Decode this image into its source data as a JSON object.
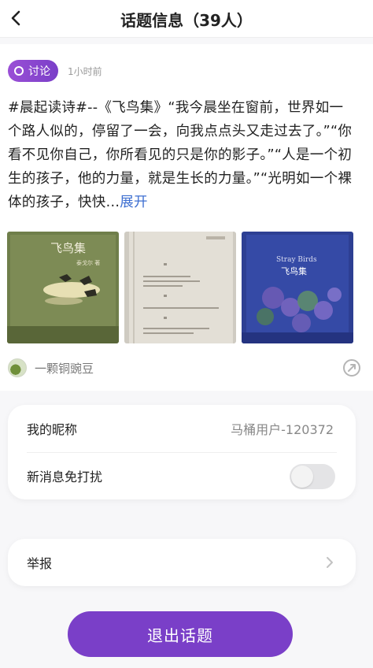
{
  "header": {
    "title": "话题信息（39人）"
  },
  "post": {
    "tag_label": "讨论",
    "time": "1小时前",
    "content": "#晨起读诗#--《飞鸟集》“我今晨坐在窗前，世界如一个路人似的，停留了一会，向我点点头又走过去了。”“你看不见你自己，你所看见的只是你的影子。”“人是一个初生的孩子，他的力量，就是生长的力量。”“光明如一个裸体的孩子，快快...",
    "expand_label": "展开",
    "images": [
      {
        "title": "飞鸟集",
        "subtitle": "泰戈尔 著",
        "icon": "book-cover-image"
      },
      {
        "icon": "book-page-image"
      },
      {
        "title": "Stray Birds",
        "subtitle": "飞鸟集",
        "icon": "book-cover-image"
      }
    ],
    "author": "一颗铜豌豆"
  },
  "settings": {
    "nickname_label": "我的昵称",
    "nickname_value": "马桶用户-120372",
    "dnd_label": "新消息免打扰",
    "dnd_enabled": false,
    "report_label": "举报"
  },
  "exit_label": "退出话题",
  "colors": {
    "accent": "#7a3fc8",
    "link": "#3e6fd1"
  }
}
